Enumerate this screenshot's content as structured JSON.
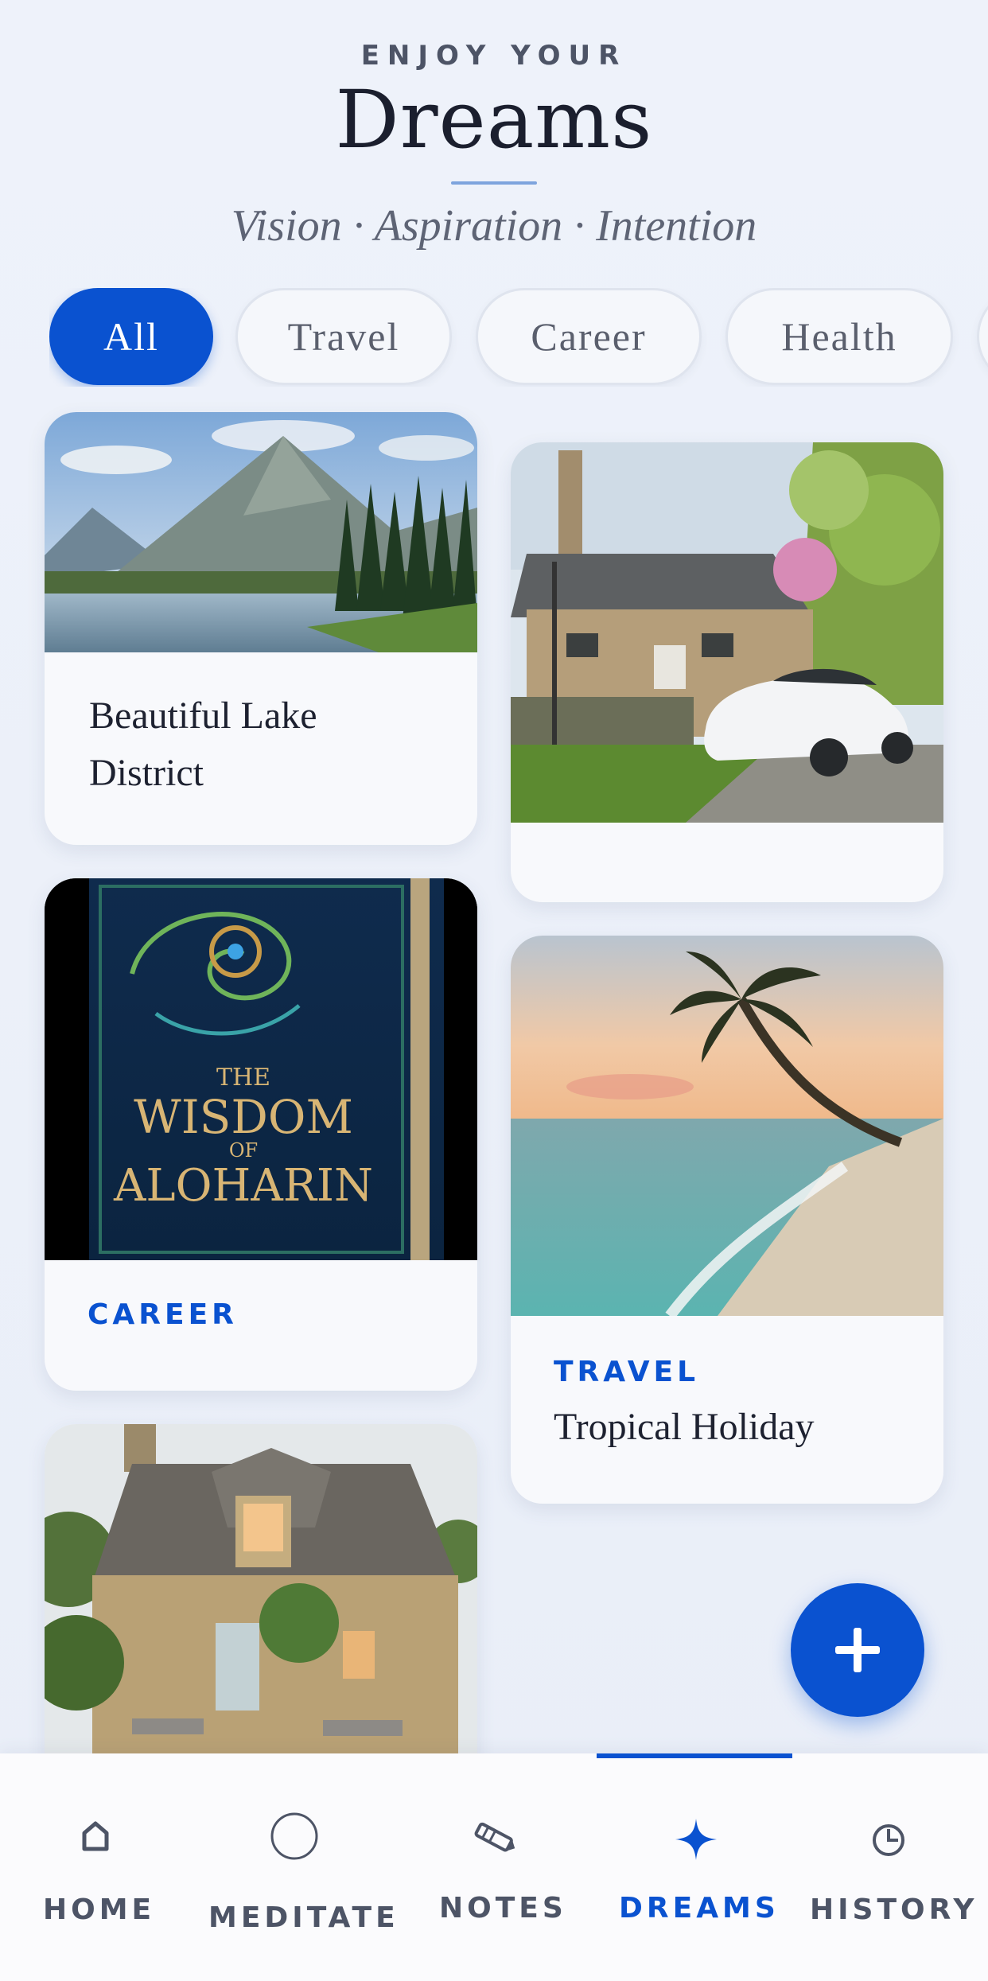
{
  "header": {
    "eyebrow": "ENJOY YOUR",
    "title": "Dreams",
    "subtitle": "Vision · Aspiration · Intention"
  },
  "filters": {
    "items": [
      "All",
      "Travel",
      "Career",
      "Health"
    ],
    "selected": "All"
  },
  "cards": [
    {
      "category": "",
      "title": "Beautiful Lake District",
      "image": "mountain-lake-photo"
    },
    {
      "category": "",
      "title": "",
      "image": "cottage-with-white-car-photo"
    },
    {
      "category": "CAREER",
      "title": "",
      "image": "wisdom-of-aloharin-book-photo"
    },
    {
      "category": "TRAVEL",
      "title": "Tropical Holiday",
      "image": "tropical-beach-palm-photo"
    },
    {
      "category": "",
      "title": "",
      "image": "stone-cottage-photo"
    }
  ],
  "book_cover": {
    "line1": "THE",
    "line2": "WISDOM",
    "line3": "OF",
    "line4": "ALOHARIN"
  },
  "fab": {
    "icon": "plus-icon"
  },
  "nav": {
    "items": [
      {
        "label": "HOME",
        "icon": "home-icon"
      },
      {
        "label": "MEDITATE",
        "icon": "circle-icon"
      },
      {
        "label": "NOTES",
        "icon": "pencil-icon"
      },
      {
        "label": "DREAMS",
        "icon": "sparkle-icon"
      },
      {
        "label": "HISTORY",
        "icon": "clock-icon"
      }
    ],
    "active": "DREAMS"
  },
  "colors": {
    "accent": "#0a52d0",
    "background": "#ecf1f9",
    "text": "#1d2130",
    "muted": "#4d5466"
  }
}
